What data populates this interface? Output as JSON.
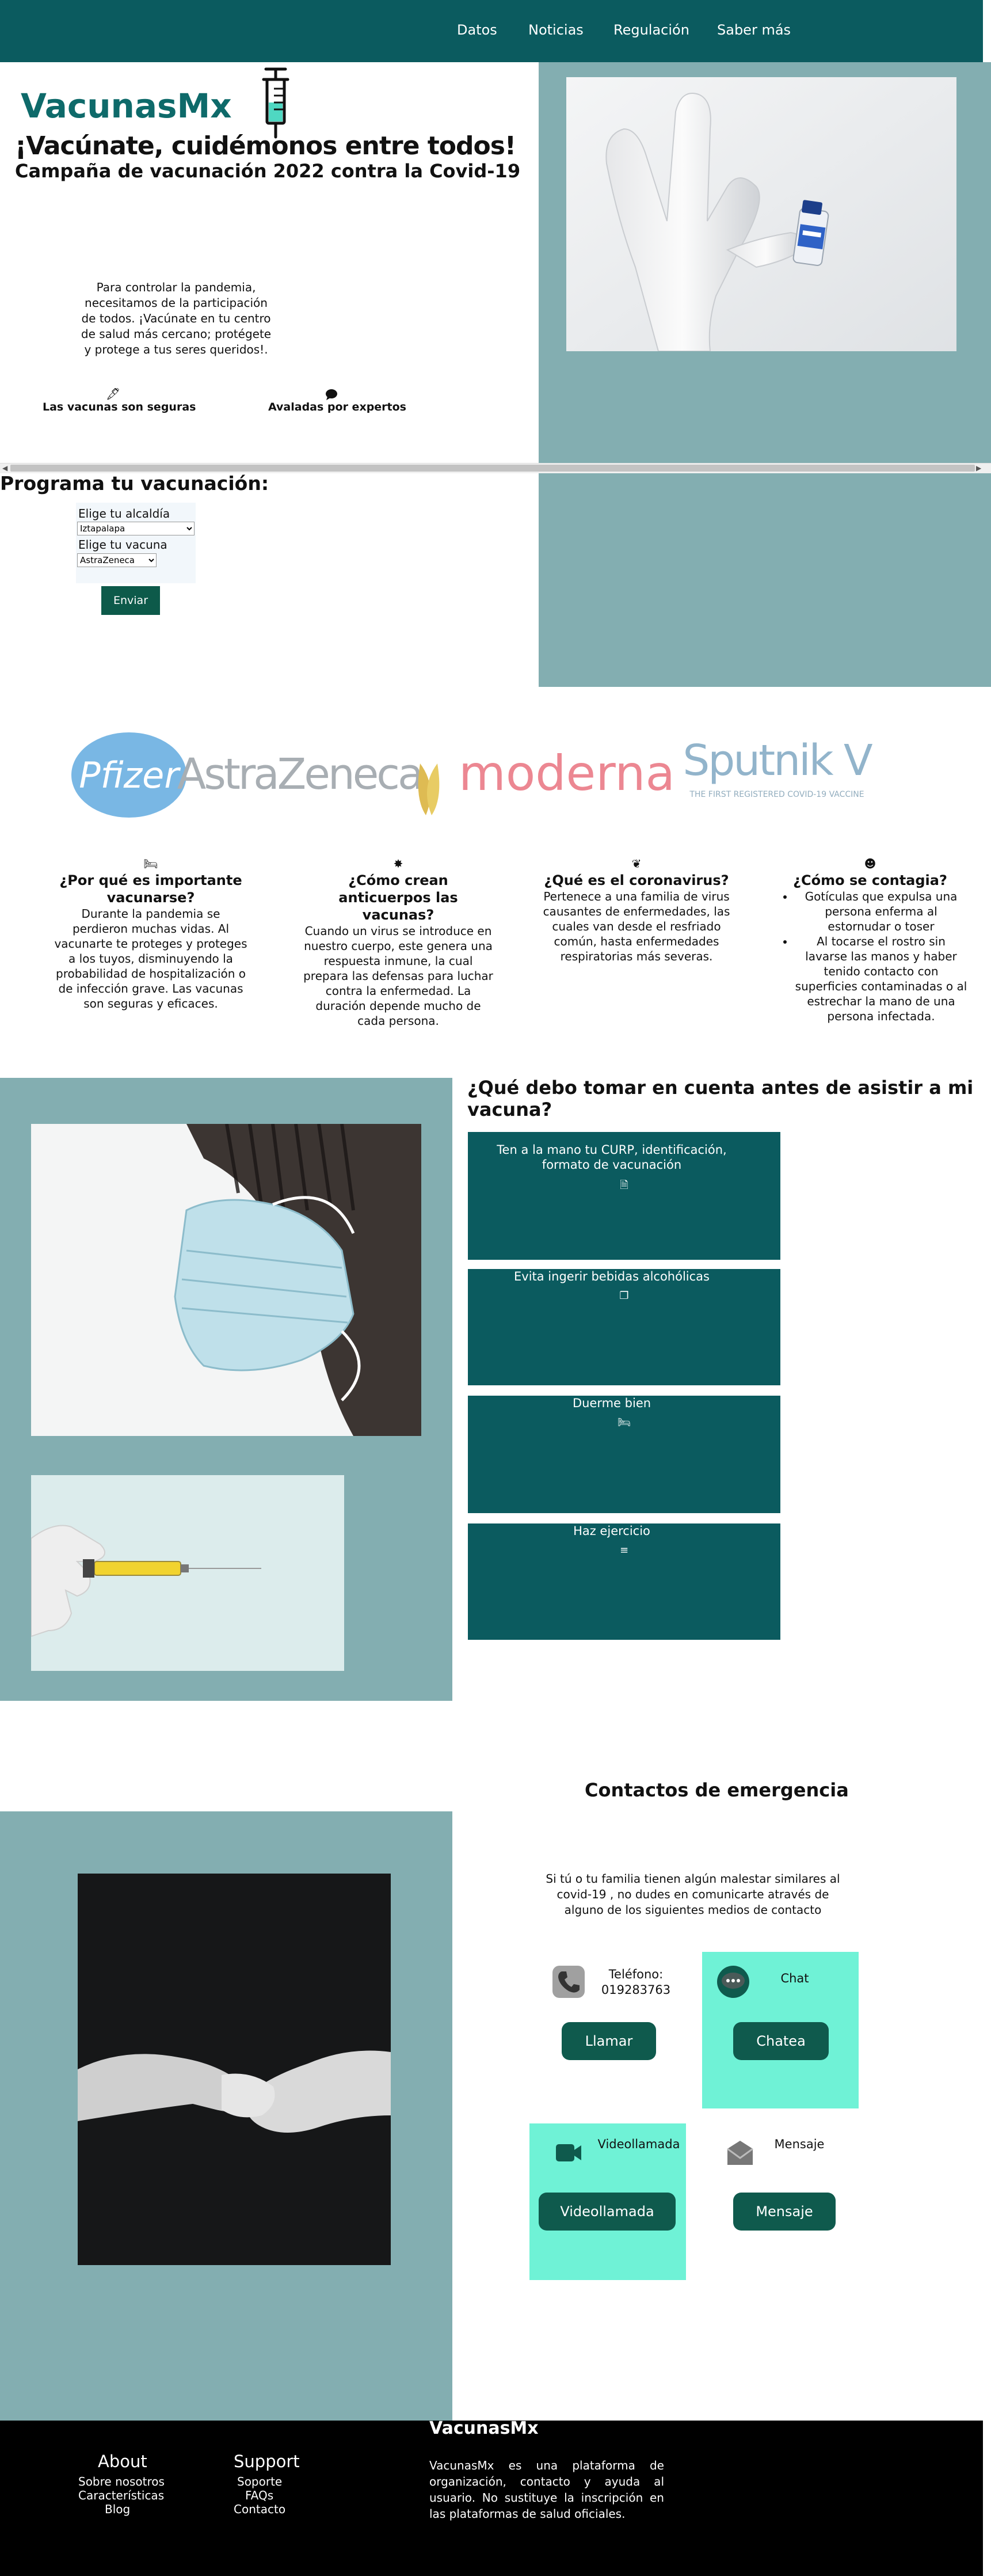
{
  "nav": {
    "items": [
      "Datos",
      "Noticias",
      "Regulación",
      "Saber más"
    ]
  },
  "hero": {
    "logo": "VacunasMx",
    "headline": "¡Vacúnate, cuidémonos entre todos!",
    "subheadline": "Campaña de vacunación 2022 contra la Covid-19",
    "intro": "Para controlar la pandemia, necesitamos de la participación de todos. ¡Vacúnate en tu centro de salud más cercano; protégete y protege a tus seres queridos!.",
    "features": [
      {
        "icon": "feather-icon",
        "label": "Las vacunas son seguras"
      },
      {
        "icon": "comment-icon",
        "label": "Avaladas por expertos"
      }
    ]
  },
  "form": {
    "title": "Programa tu vacunación:",
    "alcaldia_label": "Elige tu alcaldía",
    "alcaldia_value": "Iztapalapa",
    "vacuna_label": "Elige tu vacuna",
    "vacuna_value": "AstraZeneca",
    "submit": "Enviar"
  },
  "brands": [
    "Pfizer",
    "AstraZeneca",
    "moderna",
    "Sputnik V",
    "THE FIRST REGISTERED COVID-19 VACCINE"
  ],
  "faq": [
    {
      "icon": "bed-icon",
      "title": "¿Por qué es importante vacunarse?",
      "body": "Durante la pandemia se perdieron muchas vidas. Al vacunarte te proteges y proteges a los tuyos, disminuyendo la probabilidad de hospitalización o de infección grave. Las vacunas son seguras y eficaces."
    },
    {
      "icon": "virus-icon",
      "title": "¿Cómo crean anticuerpos las vacunas?",
      "body": "Cuando un virus se introduce en nuestro cuerpo, este genera una respuesta inmune, la cual prepara las defensas para luchar contra la enfermedad. La duración depende mucho de cada persona."
    },
    {
      "icon": "lungs-icon",
      "title": "¿Qué es el coronavirus?",
      "body": "Pertenece a una familia de virus causantes de enfermedades, las cuales van desde el resfriado común, hasta enfermedades respiratorias más severas."
    },
    {
      "icon": "head-cough-icon",
      "title": "¿Cómo se contagia?",
      "items": [
        "Gotículas que expulsa una persona enferma al estornudar o toser",
        "Al tocarse el rostro sin lavarse las manos y haber tenido contacto con superficies contaminadas o al estrechar la mano de una persona infectada."
      ]
    }
  ],
  "tips": {
    "title": "¿Qué debo tomar en cuenta antes de asistir a mi vacuna?",
    "items": [
      {
        "label": "Ten a la mano tu CURP, identificación, formato de vacunación",
        "icon": "file-icon"
      },
      {
        "label": "Evita ingerir bebidas alcohólicas",
        "icon": "no-drink-icon"
      },
      {
        "label": "Duerme bien",
        "icon": "bed-icon"
      },
      {
        "label": "Haz ejercicio",
        "icon": "dumbbell-icon"
      }
    ]
  },
  "contacts": {
    "title": "Contactos de emergencia",
    "intro": "Si tú o tu familia tienen algún malestar similares al covid-19 , no dudes en comunicarte através de alguno de los siguientes medios de contacto",
    "items": [
      {
        "icon": "phone-icon",
        "label": "Teléfono: 019283763",
        "button": "Llamar"
      },
      {
        "icon": "chat-icon",
        "label": "Chat",
        "button": "Chatea"
      },
      {
        "icon": "video-icon",
        "label": "Videollamada",
        "button": "Videollamada"
      },
      {
        "icon": "mail-icon",
        "label": "Mensaje",
        "button": "Mensaje"
      }
    ]
  },
  "footer": {
    "about": {
      "title": "About",
      "links": [
        "Sobre nosotros",
        "Características",
        "Blog"
      ]
    },
    "support": {
      "title": "Support",
      "links": [
        "Soporte",
        "FAQs",
        "Contacto"
      ]
    },
    "brand": "VacunasMx",
    "description": "VacunasMx es una plataforma de organización, contacto y ayuda al usuario. No sustituye la inscripción en las plataformas de salud oficiales."
  },
  "colors": {
    "primary": "#0b5b5f",
    "secondary": "#83aeb1",
    "accent": "#6ff2d6",
    "button": "#0f5a4d"
  }
}
